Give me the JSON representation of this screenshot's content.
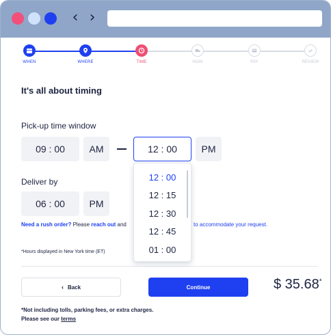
{
  "stepper": {
    "steps": [
      {
        "label": "WHEN",
        "state": "done",
        "icon": "calendar-icon"
      },
      {
        "label": "WHERE",
        "state": "done",
        "icon": "map-pin-icon"
      },
      {
        "label": "TIME",
        "state": "active",
        "icon": "clock-icon"
      },
      {
        "label": "HOW",
        "state": "todo",
        "icon": "truck-icon"
      },
      {
        "label": "PAY",
        "state": "todo",
        "icon": "card-icon"
      },
      {
        "label": "REVIEW",
        "state": "todo",
        "icon": "check-icon"
      }
    ]
  },
  "main": {
    "heading": "It's all about timing",
    "pickup_label": "Pick-up time window",
    "pickup_from_time": "09 : 00",
    "pickup_from_period": "AM",
    "pickup_to_time": "12 : 00",
    "pickup_to_period": "PM",
    "deliver_label": "Deliver by",
    "deliver_time": "06 : 00",
    "deliver_period": "PM",
    "rush_question": "Need a rush order?",
    "rush_please": " Please ",
    "rush_link": "reach out",
    "rush_and": " and",
    "rush_tail": "to accommodate your request.",
    "tz_note": "*Hours displayed in New York time (ET)"
  },
  "dropdown": {
    "options": [
      "12 : 00",
      "12 : 15",
      "12 : 30",
      "12 : 45",
      "01 : 00"
    ],
    "selected": "12 : 00"
  },
  "actions": {
    "back_label": "Back",
    "continue_label": "Continue"
  },
  "price": {
    "amount": "$ 35.68",
    "mark": "*"
  },
  "footer": {
    "note": "*Not including tolls, parking fees, or extra charges.",
    "see_prefix": "Please see our ",
    "terms_link": "terms"
  },
  "colors": {
    "accent": "#1f40f0",
    "active_step": "#ee4f74",
    "titlebar": "#8fa6c8",
    "text": "#1c2340"
  }
}
